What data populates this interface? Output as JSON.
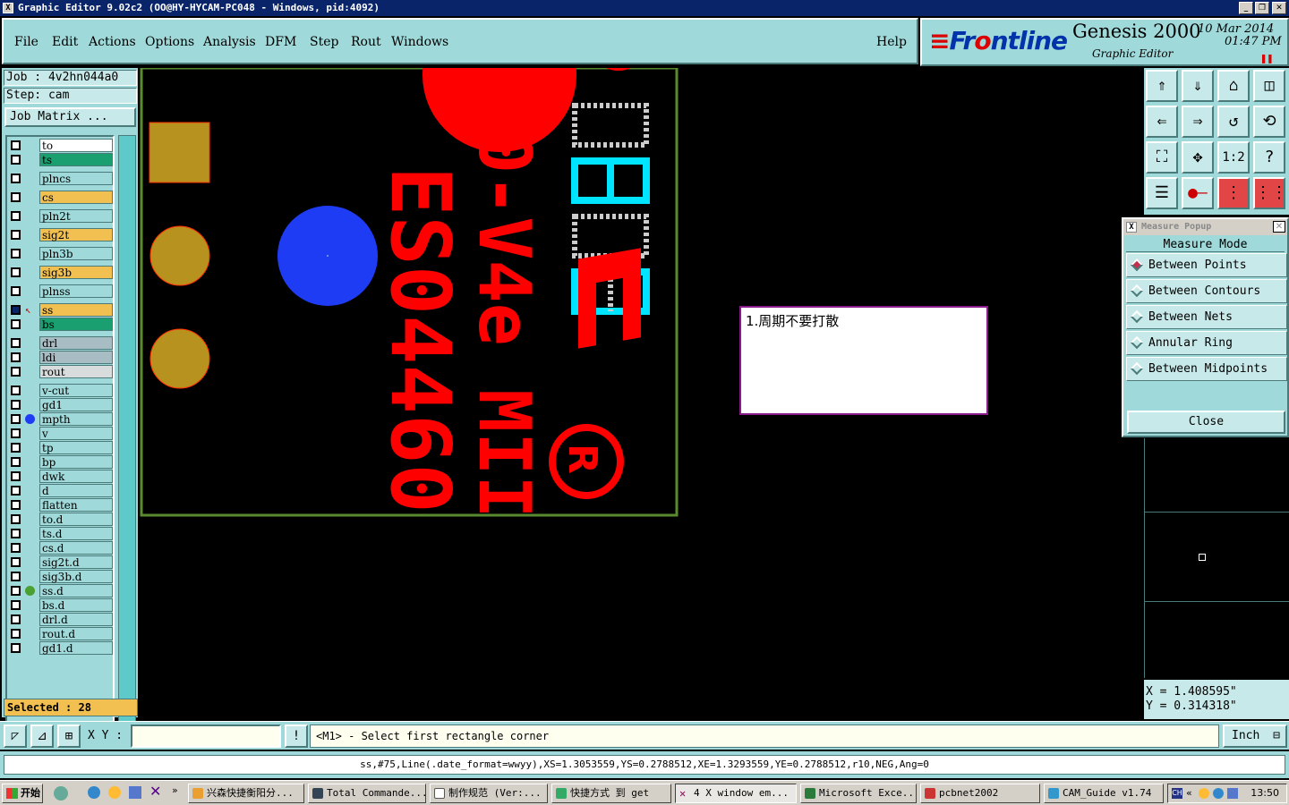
{
  "window": {
    "title": "Graphic Editor 9.02c2  (OO@HY-HYCAM-PC048 - Windows, pid:4092)",
    "icon": "x-window-icon"
  },
  "menu": {
    "items": [
      "File",
      "Edit",
      "Actions",
      "Options",
      "Analysis",
      "DFM",
      "Step",
      "Rout",
      "Windows"
    ],
    "help": "Help"
  },
  "logo": {
    "brand_a": "Fr",
    "brand_b": "ntline",
    "product": "Genesis 2000",
    "subtitle": "Graphic Editor",
    "date": "10 Mar 2014",
    "time": "01:47 PM"
  },
  "left": {
    "job": "Job : 4v2hn044a0",
    "step": "Step: cam",
    "job_matrix": "Job Matrix ...",
    "selected": "Selected : 28"
  },
  "layers": [
    {
      "name": "to",
      "color": "#ffffff",
      "mark": ""
    },
    {
      "name": "ts",
      "color": "#1aa070",
      "mark": ""
    },
    {
      "name": "plncs",
      "color": "#9fd9d9",
      "mark": ""
    },
    {
      "name": "cs",
      "color": "#f2c050",
      "mark": ""
    },
    {
      "name": "pln2t",
      "color": "#9fd9d9",
      "mark": ""
    },
    {
      "name": "sig2t",
      "color": "#f2c050",
      "mark": ""
    },
    {
      "name": "pln3b",
      "color": "#9fd9d9",
      "mark": ""
    },
    {
      "name": "sig3b",
      "color": "#f2c050",
      "mark": ""
    },
    {
      "name": "plnss",
      "color": "#9fd9d9",
      "mark": ""
    },
    {
      "name": "ss",
      "color": "#f2c050",
      "mark": "work"
    },
    {
      "name": "bs",
      "color": "#1aa070",
      "mark": ""
    },
    {
      "name": "drl",
      "color": "#a8bcc4",
      "mark": ""
    },
    {
      "name": "ldi",
      "color": "#a8bcc4",
      "mark": ""
    },
    {
      "name": "rout",
      "color": "#d8dcdc",
      "mark": ""
    },
    {
      "name": "v-cut",
      "color": "#9fd9d9",
      "mark": ""
    },
    {
      "name": "gd1",
      "color": "#9fd9d9",
      "mark": ""
    },
    {
      "name": "mpth",
      "color": "#9fd9d9",
      "mark": "blue"
    },
    {
      "name": "v",
      "color": "#9fd9d9",
      "mark": ""
    },
    {
      "name": "tp",
      "color": "#9fd9d9",
      "mark": ""
    },
    {
      "name": "bp",
      "color": "#9fd9d9",
      "mark": ""
    },
    {
      "name": "dwk",
      "color": "#9fd9d9",
      "mark": ""
    },
    {
      "name": "d",
      "color": "#9fd9d9",
      "mark": ""
    },
    {
      "name": "flatten",
      "color": "#9fd9d9",
      "mark": ""
    },
    {
      "name": "to.d",
      "color": "#9fd9d9",
      "mark": ""
    },
    {
      "name": "ts.d",
      "color": "#9fd9d9",
      "mark": ""
    },
    {
      "name": "cs.d",
      "color": "#9fd9d9",
      "mark": ""
    },
    {
      "name": "sig2t.d",
      "color": "#9fd9d9",
      "mark": ""
    },
    {
      "name": "sig3b.d",
      "color": "#9fd9d9",
      "mark": ""
    },
    {
      "name": "ss.d",
      "color": "#9fd9d9",
      "mark": "green"
    },
    {
      "name": "bs.d",
      "color": "#9fd9d9",
      "mark": ""
    },
    {
      "name": "drl.d",
      "color": "#9fd9d9",
      "mark": ""
    },
    {
      "name": "rout.d",
      "color": "#9fd9d9",
      "mark": ""
    },
    {
      "name": "gd1.d",
      "color": "#9fd9d9",
      "mark": ""
    }
  ],
  "canvas": {
    "text_1": "ES04460",
    "text_2": "0-V4e MII",
    "note": "1.周期不要打散"
  },
  "tools": {
    "ratio": "1:2",
    "help": "?"
  },
  "measure": {
    "title": "Measure Popup",
    "mode_label": "Measure Mode",
    "options": [
      "Between Points",
      "Between Contours",
      "Between Nets",
      "Annular Ring",
      "Between Midpoints"
    ],
    "selected_index": 0,
    "close": "Close"
  },
  "coords": {
    "x": "X  =  1.408595\"",
    "y": "Y  =  0.314318\""
  },
  "cmd": {
    "xy_label": "X Y :",
    "xy_value": "",
    "prompt": "<M1> - Select first rectangle corner",
    "unit": "Inch"
  },
  "status": {
    "line": "ss,#75,Line(.date_format=wwyy),XS=1.3053559,YS=0.2788512,XE=1.3293559,YE=0.2788512,r10,NEG,Ang=0"
  },
  "taskbar": {
    "start": "开始",
    "tasks": [
      "兴森快捷衡阳分...",
      "Total Commande...",
      "制作规范 (Ver:...",
      "快捷方式 到 get",
      "4 X window em...",
      "Microsoft Exce...",
      "pcbnet2002",
      "CAM_Guide v1.74"
    ],
    "clock": "13:50"
  }
}
